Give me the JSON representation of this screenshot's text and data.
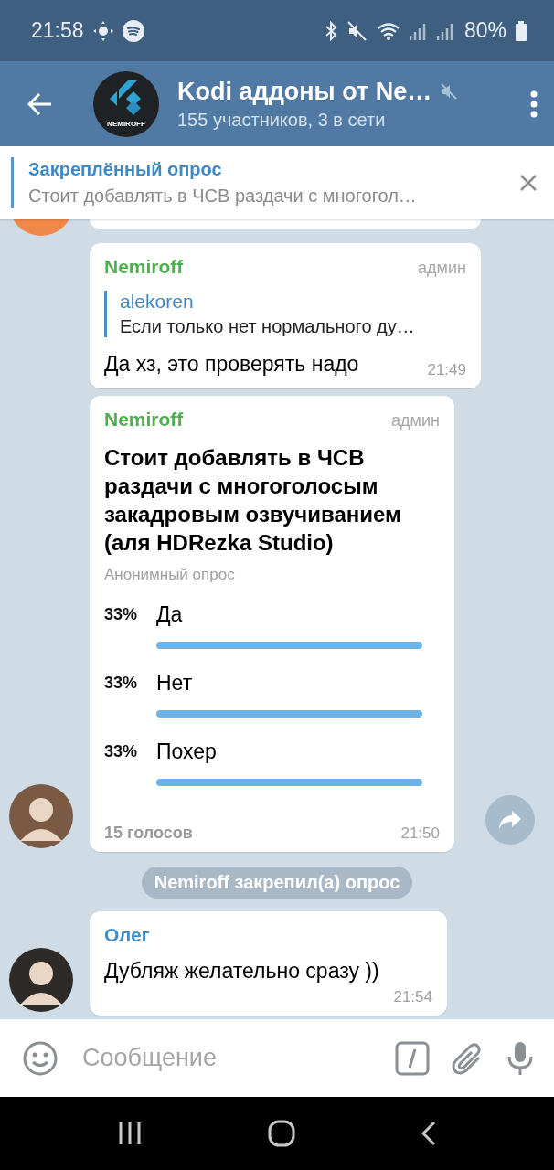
{
  "status_bar": {
    "time": "21:58",
    "battery": "80%"
  },
  "header": {
    "avatar_label": "NEMIROFF",
    "title": "Kodi аддоны от Ne…",
    "subtitle": "155 участников, 3 в сети",
    "muted": true
  },
  "pinned": {
    "title": "Закреплённый опрос",
    "text": "Стоит добавлять в ЧСВ раздачи с многогол…"
  },
  "messages": [
    {
      "kind": "clipped"
    },
    {
      "kind": "text",
      "author": "Nemiroff",
      "color": "#4fae4e",
      "role": "админ",
      "reply": {
        "author": "alekoren",
        "text": "Если только нет нормального ду…"
      },
      "text": "Да хз, это проверять надо",
      "time": "21:49"
    },
    {
      "kind": "poll",
      "author": "Nemiroff",
      "color": "#4fae4e",
      "role": "админ",
      "question": "Стоит добавлять в ЧСВ раздачи с многоголосым закадровым озвучиванием (аля HDRezka Studio)",
      "poll_type": "Анонимный опрос",
      "options": [
        {
          "percent": "33%",
          "label": "Да"
        },
        {
          "percent": "33%",
          "label": "Нет"
        },
        {
          "percent": "33%",
          "label": "Похер"
        }
      ],
      "votes": "15 голосов",
      "time": "21:50",
      "avatar": true,
      "forward": true
    },
    {
      "kind": "service",
      "text": "Nemiroff закрепил(а) опрос"
    },
    {
      "kind": "text",
      "author": "Олег",
      "color": "#3e8fcc",
      "text": "Дубляж желательно сразу ))",
      "time": "21:54",
      "avatar": true
    }
  ],
  "composer": {
    "placeholder": "Сообщение"
  }
}
